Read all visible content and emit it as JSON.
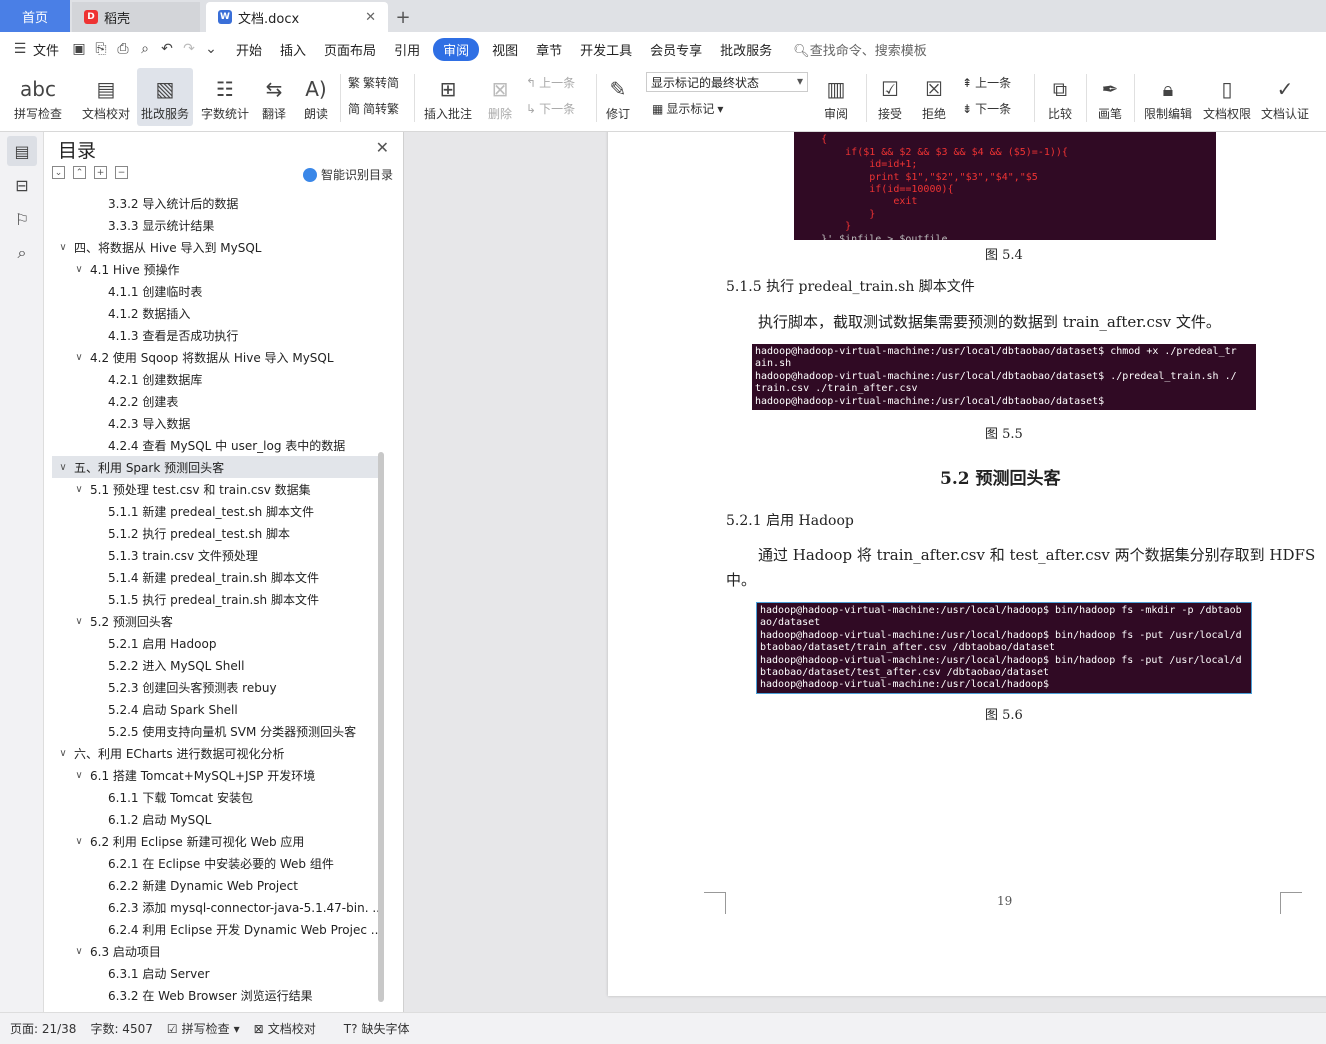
{
  "tabs": {
    "home": "首页",
    "daoke": "稻壳",
    "doc": "文档.docx",
    "plus": "+"
  },
  "menu": {
    "file": "文件",
    "items": [
      "开始",
      "插入",
      "页面布局",
      "引用",
      "审阅",
      "视图",
      "章节",
      "开发工具",
      "会员专享",
      "批改服务"
    ],
    "active_index": 4,
    "search_placeholder": "查找命令、搜索模板"
  },
  "toolbar": {
    "spell": "拼写检查",
    "proof": "文档校对",
    "correct": "批改服务",
    "wordcount": "字数统计",
    "translate": "翻译",
    "read": "朗读",
    "trad": "繁转简",
    "simp": "简转繁",
    "insert_comment": "插入批注",
    "delete": "删除",
    "prev": "上一条",
    "next": "下一条",
    "revise": "修订",
    "markup_state": "显示标记的最终状态",
    "show_markup": "显示标记",
    "review": "审阅",
    "accept": "接受",
    "reject": "拒绝",
    "prev2": "上一条",
    "next2": "下一条",
    "compare": "比较",
    "pen": "画笔",
    "restrict": "限制编辑",
    "permission": "文档权限",
    "certify": "文档认证"
  },
  "nav": {
    "title": "目录",
    "smart": "智能识别目录",
    "items": [
      {
        "level": 3,
        "text": "3.3.2  导入统计后的数据"
      },
      {
        "level": 3,
        "text": "3.3.3  显示统计结果"
      },
      {
        "level": 1,
        "text": "四、将数据从 Hive 导入到 MySQL"
      },
      {
        "level": 2,
        "text": "4.1 Hive 预操作"
      },
      {
        "level": 3,
        "text": "4.1.1  创建临时表"
      },
      {
        "level": 3,
        "text": "4.1.2  数据插入"
      },
      {
        "level": 3,
        "text": "4.1.3  查看是否成功执行"
      },
      {
        "level": 2,
        "text": "4.2  使用 Sqoop 将数据从 Hive 导入 MySQL"
      },
      {
        "level": 3,
        "text": "4.2.1  创建数据库"
      },
      {
        "level": 3,
        "text": "4.2.2  创建表"
      },
      {
        "level": 3,
        "text": "4.2.3  导入数据"
      },
      {
        "level": 3,
        "text": "4.2.4  查看 MySQL 中 user_log 表中的数据"
      },
      {
        "level": 1,
        "text": "五、利用 Spark 预测回头客",
        "selected": true
      },
      {
        "level": 2,
        "text": "5.1  预处理 test.csv 和 train.csv 数据集"
      },
      {
        "level": 3,
        "text": "5.1.1  新建 predeal_test.sh 脚本文件"
      },
      {
        "level": 3,
        "text": "5.1.2  执行 predeal_test.sh 脚本"
      },
      {
        "level": 3,
        "text": "5.1.3 train.csv 文件预处理"
      },
      {
        "level": 3,
        "text": "5.1.4  新建 predeal_train.sh 脚本文件"
      },
      {
        "level": 3,
        "text": "5.1.5  执行 predeal_train.sh 脚本文件"
      },
      {
        "level": 2,
        "text": "5.2  预测回头客"
      },
      {
        "level": 3,
        "text": "5.2.1  启用 Hadoop"
      },
      {
        "level": 3,
        "text": "5.2.2  进入 MySQL Shell"
      },
      {
        "level": 3,
        "text": "5.2.3  创建回头客预测表 rebuy"
      },
      {
        "level": 3,
        "text": "5.2.4  启动 Spark Shell"
      },
      {
        "level": 3,
        "text": "5.2.5  使用支持向量机 SVM 分类器预测回头客"
      },
      {
        "level": 1,
        "text": "六、利用 ECharts 进行数据可视化分析"
      },
      {
        "level": 2,
        "text": "6.1 搭建 Tomcat+MySQL+JSP 开发环境"
      },
      {
        "level": 3,
        "text": "6.1.1  下载 Tomcat 安装包"
      },
      {
        "level": 3,
        "text": "6.1.2  启动 MySQL"
      },
      {
        "level": 2,
        "text": "6.2 利用 Eclipse  新建可视化 Web 应用"
      },
      {
        "level": 3,
        "text": "6.2.1  在 Eclipse 中安装必要的 Web 组件"
      },
      {
        "level": 3,
        "text": "6.2.2  新建 Dynamic Web Project"
      },
      {
        "level": 3,
        "text": "6.2.3  添加 mysql-connector-java-5.1.47-bin. ..."
      },
      {
        "level": 3,
        "text": "6.2.4  利用 Eclipse  开发 Dynamic Web Projec ..."
      },
      {
        "level": 2,
        "text": "6.3 启动项目"
      },
      {
        "level": 3,
        "text": "6.3.1  启动 Server"
      },
      {
        "level": 3,
        "text": "6.3.2  在 Web Browser 浏览运行结果"
      }
    ]
  },
  "doc": {
    "term1_lines": [
      "    {",
      "    {",
      "        if($1 && $2 && $3 && $4 && ($5)=-1)){",
      "            id=id+1;",
      "            print $1\",\"$2\",\"$3\",\"$4\",\"$5",
      "            if(id==10000){",
      "                exit",
      "            }",
      "        }",
      "    }' $infile > $outfile"
    ],
    "cap1": "图 5.4",
    "h515": "5.1.5  执行 predeal_train.sh 脚本文件",
    "p1": "执行脚本，截取测试数据集需要预测的数据到 train_after.csv 文件。",
    "term2": "hadoop@hadoop-virtual-machine:/usr/local/dbtaobao/dataset$ chmod +x ./predeal_tr\nain.sh\nhadoop@hadoop-virtual-machine:/usr/local/dbtaobao/dataset$ ./predeal_train.sh ./\ntrain.csv ./train_after.csv\nhadoop@hadoop-virtual-machine:/usr/local/dbtaobao/dataset$",
    "cap2": "图 5.5",
    "h52": "5.2  预测回头客",
    "h521": "5.2.1  启用 Hadoop",
    "p2a": "通过 Hadoop 将 train_after.csv 和 test_after.csv 两个数据集分别存取到 HDFS",
    "p2b": "中。",
    "term3": "hadoop@hadoop-virtual-machine:/usr/local/hadoop$ bin/hadoop fs -mkdir -p /dbtaob\nao/dataset\nhadoop@hadoop-virtual-machine:/usr/local/hadoop$ bin/hadoop fs -put /usr/local/d\nbtaobao/dataset/train_after.csv /dbtaobao/dataset\nhadoop@hadoop-virtual-machine:/usr/local/hadoop$ bin/hadoop fs -put /usr/local/d\nbtaobao/dataset/test_after.csv /dbtaobao/dataset\nhadoop@hadoop-virtual-machine:/usr/local/hadoop$",
    "cap3": "图 5.6",
    "page_number": "19"
  },
  "status": {
    "page": "页面: 21/38",
    "words": "字数: 4507",
    "spell": "拼写检查",
    "proof": "文档校对",
    "missing_font": "缺失字体"
  }
}
